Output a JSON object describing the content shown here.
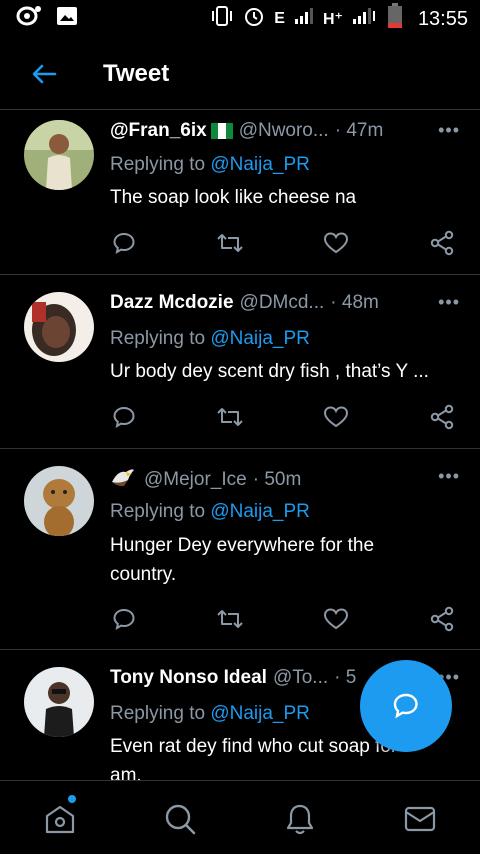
{
  "status_bar": {
    "time": "13:55",
    "network_label_1": "E",
    "network_label_2": "H⁺",
    "icons": [
      "notification-icon",
      "image-icon",
      "vibrate-icon",
      "alarm-icon",
      "signal-icon",
      "battery-icon"
    ]
  },
  "app_bar": {
    "title": "Tweet",
    "back_icon": "back-arrow-icon"
  },
  "tweets": [
    {
      "name": "@Fran_6ix",
      "has_flag": true,
      "handle": "@Nworo...",
      "time": "· 47m",
      "replying_prefix": "Replying to",
      "replying_to": "@Naija_PR",
      "text": "The soap look like cheese na"
    },
    {
      "name": "Dazz Mcdozie",
      "handle": "@DMcd...",
      "time": "· 48m",
      "replying_prefix": "Replying to",
      "replying_to": "@Naija_PR",
      "text": "Ur body dey scent dry fish , that’s Y ..."
    },
    {
      "name": "",
      "name_icon": "eagle-emoji",
      "handle": "@Mejor_Ice",
      "time": "· 50m",
      "replying_prefix": "Replying to",
      "replying_to": "@Naija_PR",
      "text": "Hunger Dey everywhere for the country."
    },
    {
      "name": "Tony Nonso Ideal",
      "handle": "@To...",
      "time": "· 5",
      "replying_prefix": "Replying to",
      "replying_to": "@Naija_PR",
      "text": "Even rat dey find who cut soap for am."
    }
  ],
  "actions": [
    "reply-icon",
    "retweet-icon",
    "like-icon",
    "share-icon"
  ],
  "more_label": "•••",
  "fab": {
    "icon": "compose-reply-icon"
  },
  "bottom_nav": {
    "items": [
      "home-icon",
      "search-icon",
      "notifications-icon",
      "messages-icon"
    ],
    "has_home_indicator": true
  },
  "colors": {
    "accent": "#1d9bf0",
    "background": "#000000",
    "muted": "#8b98a5",
    "divider": "#2f3336"
  }
}
